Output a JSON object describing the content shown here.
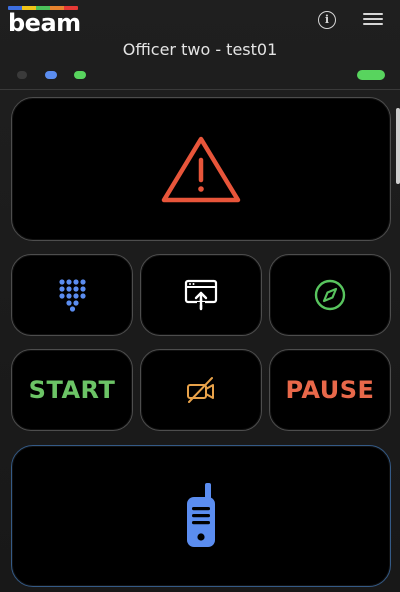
{
  "header": {
    "logo_text": "beam",
    "title": "Officer two - test01"
  },
  "status_dots": [
    "#3a3a3a",
    "#5b8df0",
    "#58d45e",
    "#58d45e"
  ],
  "buttons": {
    "start_label": "START",
    "pause_label": "PAUSE"
  },
  "icons": {
    "alarm": "warning-triangle-icon",
    "keypad": "keypad-icon",
    "share": "screen-share-icon",
    "compass": "compass-icon",
    "mute": "camera-off-icon",
    "radio": "walkie-talkie-icon"
  },
  "colors": {
    "alarm": "#e8553a",
    "keypad": "#5b8df0",
    "share": "#ffffff",
    "compass": "#58c45e",
    "mute": "#e8a24a",
    "radio": "#5b8df0",
    "start": "#6cc466",
    "pause": "#e8684a"
  }
}
